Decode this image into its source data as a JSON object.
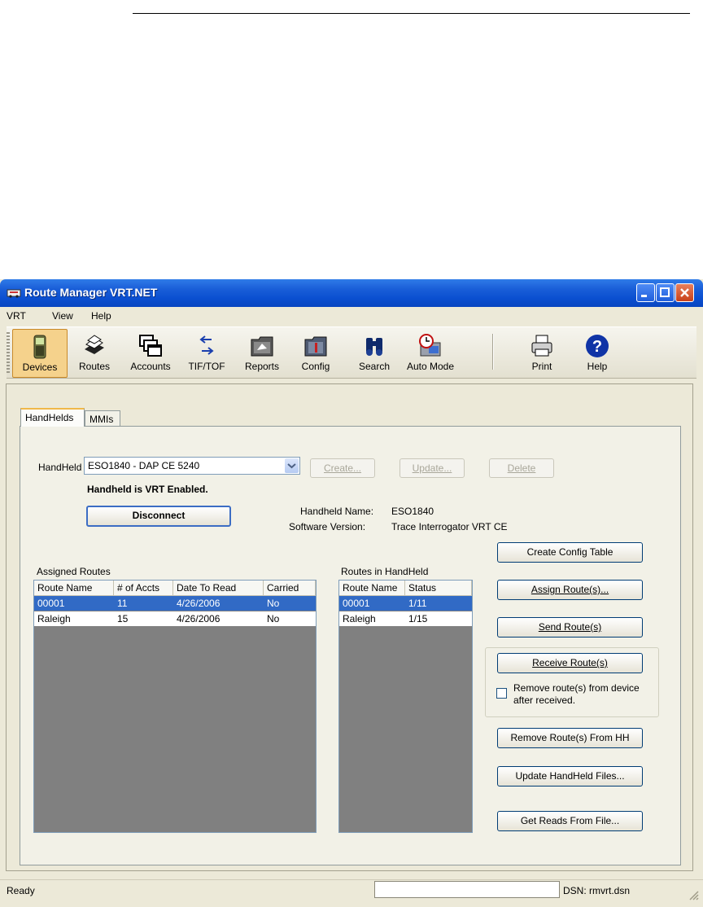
{
  "window": {
    "title": "Route Manager VRT.NET",
    "icon": "route-manager-app-icon"
  },
  "menu": [
    {
      "label": "VRT"
    },
    {
      "label": "View"
    },
    {
      "label": "Help"
    }
  ],
  "toolbar": [
    {
      "label": "Devices",
      "icon": "handheld-device-icon",
      "active": true
    },
    {
      "label": "Routes",
      "icon": "routes-stack-icon"
    },
    {
      "label": "Accounts",
      "icon": "accounts-windows-icon"
    },
    {
      "label": "TIF/TOF",
      "icon": "transfer-arrows-icon"
    },
    {
      "label": "Reports",
      "icon": "reports-folder-icon"
    },
    {
      "label": "Config",
      "icon": "config-folder-icon"
    },
    {
      "label": "Search",
      "icon": "binoculars-icon"
    },
    {
      "label": "Auto Mode",
      "icon": "auto-mode-clock-icon"
    },
    {
      "label": "Print",
      "icon": "printer-icon"
    },
    {
      "label": "Help",
      "icon": "help-question-icon"
    }
  ],
  "tabs": [
    {
      "label": "HandHelds",
      "selected": true
    },
    {
      "label": "MMIs"
    }
  ],
  "handheld": {
    "label": "HandHeld",
    "selected_value": "ESO1840 - DAP CE 5240",
    "create_label": "Create...",
    "update_label": "Update...",
    "delete_label": "Delete",
    "status_text": "Handheld is VRT Enabled.",
    "disconnect_label": "Disconnect",
    "name_label": "Handheld Name:",
    "name_value": "ESO1840",
    "software_label": "Software Version:",
    "software_value": "Trace Interrogator VRT CE"
  },
  "assigned_routes": {
    "title": "Assigned Routes",
    "columns": [
      "Route Name",
      "# of Accts",
      "Date To Read",
      "Carried"
    ],
    "rows": [
      [
        "00001",
        "11",
        "4/26/2006",
        "No"
      ],
      [
        "Raleigh",
        "15",
        "4/26/2006",
        "No"
      ]
    ],
    "selected_row": 0
  },
  "handheld_routes": {
    "title": "Routes in HandHeld",
    "columns": [
      "Route Name",
      "Status"
    ],
    "rows": [
      [
        "00001",
        "1/11"
      ],
      [
        "Raleigh",
        "1/15"
      ]
    ],
    "selected_row": 0
  },
  "actions": {
    "create_config": "Create Config Table",
    "assign_routes": "Assign Route(s)...",
    "send_routes": "Send Route(s)",
    "receive_routes": "Receive Route(s)",
    "remove_after_line1": "Remove route(s) from device",
    "remove_after_line2": "after received.",
    "remove_after_checked": false,
    "remove_from_hh": "Remove Route(s) From HH",
    "update_files": "Update HandHeld Files...",
    "get_reads": "Get Reads From File..."
  },
  "status": {
    "text": "Ready",
    "dsn": "DSN: rmvrt.dsn"
  }
}
